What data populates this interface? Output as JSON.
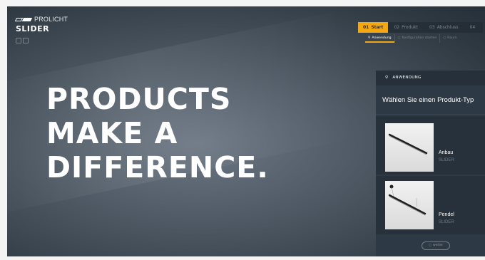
{
  "brand": {
    "name": "PROLICHT",
    "product": "SLIDER"
  },
  "headline": {
    "lines": [
      "PRODUCTS",
      "MAKE A",
      "DIFFERENCE."
    ]
  },
  "steps": {
    "tabs": [
      {
        "num": "01",
        "label": "Start",
        "active": true
      },
      {
        "num": "02",
        "label": "Produkt",
        "active": false
      },
      {
        "num": "03",
        "label": "Abschluss",
        "active": false
      },
      {
        "num": "04",
        "label": "",
        "active": false
      }
    ],
    "subtabs": [
      {
        "label": "Anwendung",
        "icon": "lightbulb-icon",
        "active": true
      },
      {
        "label": "Konfiguration starten",
        "icon": "circle-icon",
        "active": false
      },
      {
        "label": "Raum",
        "icon": "circle-icon",
        "active": false
      }
    ]
  },
  "panel": {
    "header": "ANWENDUNG",
    "header_icon": "lightbulb-icon",
    "title": "Wählen Sie einen Produkt-Typ",
    "products": [
      {
        "name": "Anbau",
        "line": "SLIDER",
        "mount": "surface"
      },
      {
        "name": "Pendel",
        "line": "SLIDER",
        "mount": "pendant"
      }
    ],
    "next_label": "weiter"
  },
  "colors": {
    "accent": "#f3a712",
    "panel_bg": "#2d3944",
    "panel_header_bg": "#25303a"
  }
}
